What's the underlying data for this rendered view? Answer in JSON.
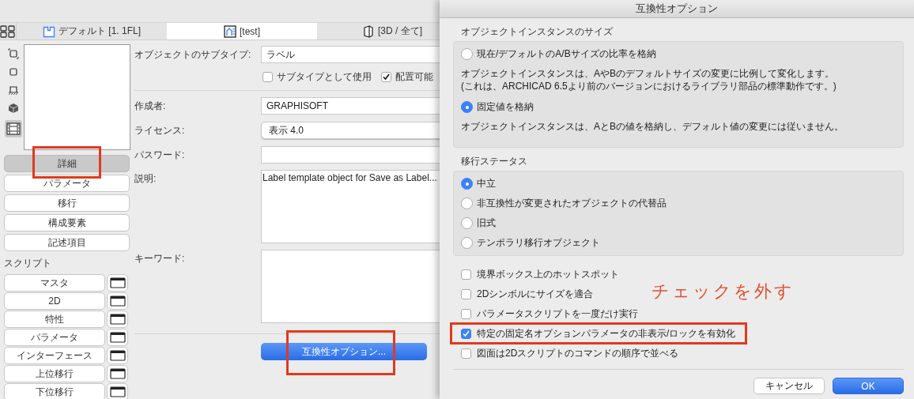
{
  "view_tabs": [
    {
      "label": "デフォルト [1. 1FL]",
      "kind": "plan",
      "selected": false
    },
    {
      "label": "[test]",
      "kind": "layout",
      "selected": true
    },
    {
      "label": "[3D / 全て]",
      "kind": "box",
      "selected": false
    }
  ],
  "side_tools": [
    {
      "kind": "frame",
      "selected": false
    },
    {
      "kind": "square",
      "selected": false
    },
    {
      "kind": "plan",
      "selected": false
    },
    {
      "kind": "cube",
      "selected": false
    },
    {
      "kind": "film",
      "selected": true
    }
  ],
  "detail_nav": [
    {
      "label": "詳細",
      "selected": true
    },
    {
      "label": "パラメータ",
      "selected": false
    },
    {
      "label": "移行",
      "selected": false
    },
    {
      "label": "構成要素",
      "selected": false
    },
    {
      "label": "記述項目",
      "selected": false
    }
  ],
  "scripts_heading": "スクリプト",
  "scripts": [
    {
      "label": "マスタ"
    },
    {
      "label": "2D"
    },
    {
      "label": "特性"
    },
    {
      "label": "パラメータ"
    },
    {
      "label": "インターフェース"
    },
    {
      "label": "上位移行"
    },
    {
      "label": "下位移行"
    }
  ],
  "form": {
    "subtype": {
      "label": "オブジェクトのサブタイプ:",
      "value": "ラベル"
    },
    "checkboxes": [
      {
        "label": "サブタイプとして使用",
        "checked": false
      },
      {
        "label": "配置可能",
        "checked": true
      }
    ],
    "fields": [
      {
        "label": "作成者:",
        "kind": "text",
        "value": "GRAPHISOFT"
      },
      {
        "label": "ライセンス:",
        "kind": "popup",
        "value": "表示 4.0"
      },
      {
        "label": "パスワード:",
        "kind": "text"
      },
      {
        "label": "説明:",
        "kind": "area",
        "value": "Label template object for Save as Label..."
      },
      {
        "label": "キーワード:",
        "kind": "area"
      }
    ],
    "action": "互換性オプション..."
  },
  "dialog": {
    "title": "互換性オプション",
    "sections": [
      {
        "heading": "オブジェクトインスタンスのサイズ",
        "items": [
          {
            "kind": "radio",
            "label": "現在/デフォルトのA/Bサイズの比率を格納",
            "selected": false
          },
          {
            "kind": "note",
            "text": "オブジェクトインスタンスは、AやBのデフォルトサイズの変更に比例して変化します。\n(これは、ARCHICAD 6.5より前のバージョンにおけるライブラリ部品の標準動作です。)"
          },
          {
            "kind": "radio",
            "label": "固定値を格納",
            "selected": true
          },
          {
            "kind": "note",
            "text": "オブジェクトインスタンスは、AとBの値を格納し、デフォルト値の変更には従いません。"
          }
        ]
      },
      {
        "heading": "移行ステータス",
        "items": [
          {
            "kind": "radio",
            "label": "中立",
            "selected": true
          },
          {
            "kind": "radio",
            "label": "非互換性が変更されたオブジェクトの代替品",
            "selected": false
          },
          {
            "kind": "radio",
            "label": "旧式",
            "selected": false
          },
          {
            "kind": "radio",
            "label": "テンポラリ移行オブジェクト",
            "selected": false
          }
        ]
      }
    ],
    "checkboxes": [
      {
        "label": "境界ボックス上のホットスポット",
        "checked": false
      },
      {
        "label": "2Dシンボルにサイズを適合",
        "checked": false
      },
      {
        "label": "パラメータスクリプトを一度だけ実行",
        "checked": false
      },
      {
        "label": "特定の固定名オプションパラメータの非表示/ロックを有効化",
        "checked": true
      },
      {
        "label": "図面は2Dスクリプトのコマンドの順序で並べる",
        "checked": false
      }
    ],
    "buttons": [
      {
        "label": "キャンセル",
        "default": false
      },
      {
        "label": "OK",
        "default": true
      }
    ]
  },
  "annotations": [
    {
      "kind": "frame"
    },
    {
      "kind": "frame"
    },
    {
      "kind": "frame"
    },
    {
      "kind": "text",
      "text": "チェックを外す"
    }
  ]
}
